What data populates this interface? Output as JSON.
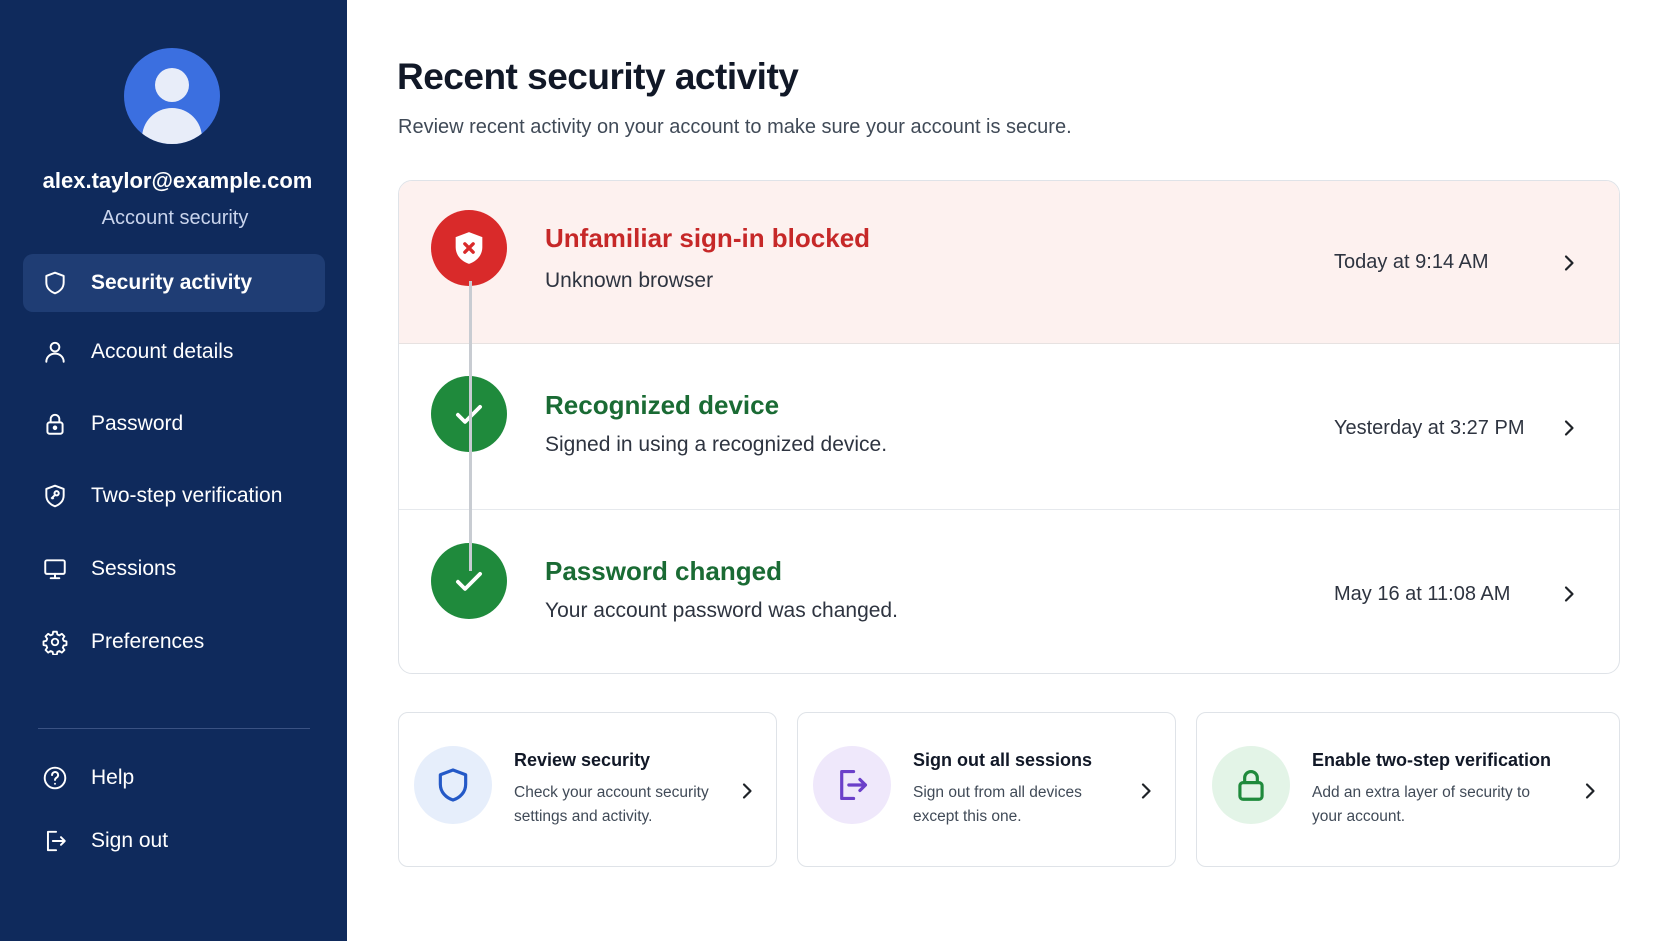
{
  "sidebar": {
    "user": {
      "email": "alex.taylor@example.com",
      "subtitle": "Account security"
    },
    "items": [
      {
        "label": "Security activity",
        "icon": "shield-icon",
        "active": true
      },
      {
        "label": "Account details",
        "icon": "person-icon",
        "active": false
      },
      {
        "label": "Password",
        "icon": "lock-icon",
        "active": false
      },
      {
        "label": "Two-step verification",
        "icon": "shield-key-icon",
        "active": false
      },
      {
        "label": "Sessions",
        "icon": "monitor-icon",
        "active": false
      },
      {
        "label": "Preferences",
        "icon": "gear-icon",
        "active": false
      }
    ],
    "bottom_items": [
      {
        "label": "Help",
        "icon": "help-circle-icon"
      },
      {
        "label": "Sign out",
        "icon": "sign-out-icon"
      }
    ]
  },
  "main": {
    "title": "Recent security activity",
    "subtitle": "Review recent activity on your account to make sure your account is secure.",
    "activities": [
      {
        "title": "Unfamiliar sign-in blocked",
        "description": "Unknown browser",
        "time": "Today at 9:14 AM",
        "status": "danger",
        "icon": "shield-x-icon"
      },
      {
        "title": "Recognized device",
        "description": "Signed in using a recognized device.",
        "time": "Yesterday at 3:27 PM",
        "status": "ok",
        "icon": "check-icon"
      },
      {
        "title": "Password changed",
        "description": "Your account password was changed.",
        "time": "May 16 at 11:08 AM",
        "status": "ok",
        "icon": "check-icon"
      }
    ],
    "actions": [
      {
        "title": "Review security",
        "description": "Check your account security settings and activity.",
        "icon": "shield-icon"
      },
      {
        "title": "Sign out all sessions",
        "description": "Sign out from all devices except this one.",
        "icon": "sign-out-icon"
      },
      {
        "title": "Enable two-step verification",
        "description": "Add an extra layer of security to your account.",
        "icon": "lock-icon"
      }
    ]
  },
  "colors": {
    "sidebar_bg": "#0f2a5c",
    "sidebar_active": "#1f3d74",
    "danger": "#d92a2a",
    "success": "#1f8a3c",
    "danger_row_bg": "#fdf1ef",
    "accent_blue": "#3b6fe0"
  }
}
